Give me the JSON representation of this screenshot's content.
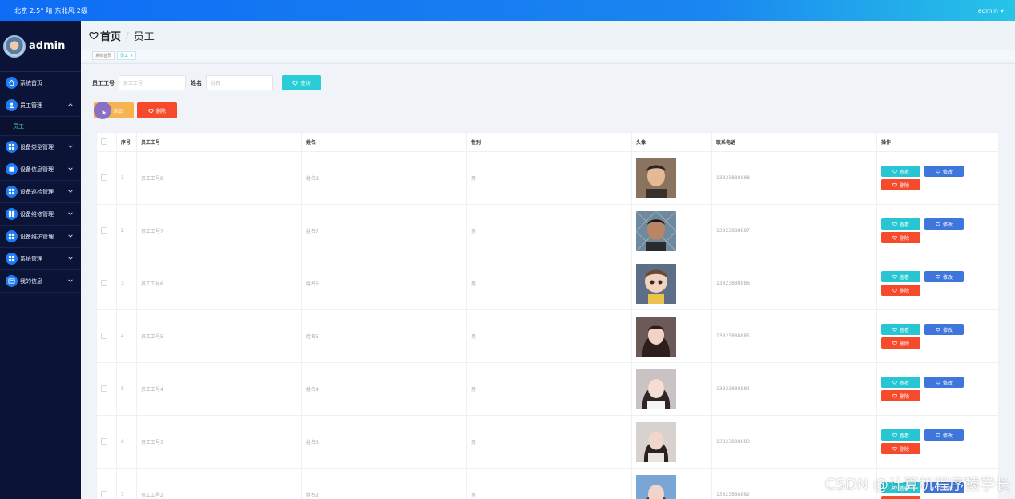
{
  "topbar": {
    "weather": "北京  2.5°  晴  东北风  2级",
    "user": "admin"
  },
  "sidebar": {
    "brand": "admin",
    "items": [
      {
        "label": "系统首页",
        "icon": "home-icon",
        "expanded": false
      },
      {
        "label": "员工管理",
        "icon": "user-icon",
        "expanded": true,
        "sub": [
          "员工"
        ]
      },
      {
        "label": "设备类型管理",
        "icon": "grid-icon",
        "expanded": false
      },
      {
        "label": "设备信息管理",
        "icon": "box-icon",
        "expanded": false
      },
      {
        "label": "设备巡检管理",
        "icon": "grid-icon",
        "expanded": false
      },
      {
        "label": "设备维修管理",
        "icon": "grid-icon",
        "expanded": false
      },
      {
        "label": "设备维护管理",
        "icon": "grid-icon",
        "expanded": false
      },
      {
        "label": "系统管理",
        "icon": "grid-icon",
        "expanded": false
      },
      {
        "label": "我的信息",
        "icon": "card-icon",
        "expanded": false
      }
    ]
  },
  "header": {
    "home": "首页",
    "current": "员工"
  },
  "tags": [
    {
      "label": "系统首页",
      "active": false
    },
    {
      "label": "员工",
      "active": true
    }
  ],
  "search": {
    "id_label": "员工工号",
    "id_placeholder": "员工工号",
    "name_label": "姓名",
    "name_placeholder": "姓名",
    "button": "查询"
  },
  "actions": {
    "add": "添加",
    "delete": "删除"
  },
  "table": {
    "columns": [
      "序号",
      "员工工号",
      "姓名",
      "性别",
      "头像",
      "联系电话",
      "操作"
    ],
    "rows": [
      {
        "no": "1",
        "id": "员工工号8",
        "name": "姓名8",
        "gender": "男",
        "phone": "13823888888"
      },
      {
        "no": "2",
        "id": "员工工号7",
        "name": "姓名7",
        "gender": "男",
        "phone": "13823888887"
      },
      {
        "no": "3",
        "id": "员工工号6",
        "name": "姓名6",
        "gender": "男",
        "phone": "13823888886"
      },
      {
        "no": "4",
        "id": "员工工号5",
        "name": "姓名5",
        "gender": "男",
        "phone": "13823888885"
      },
      {
        "no": "5",
        "id": "员工工号4",
        "name": "姓名4",
        "gender": "男",
        "phone": "13823888884"
      },
      {
        "no": "6",
        "id": "员工工号3",
        "name": "姓名3",
        "gender": "男",
        "phone": "13823888883"
      },
      {
        "no": "7",
        "id": "员工工号2",
        "name": "姓名2",
        "gender": "男",
        "phone": "13823888882"
      }
    ],
    "ops": {
      "view": "查看",
      "edit": "修改",
      "delete": "删除"
    }
  },
  "watermark": "CSDN @计算机程序猿学长",
  "colors": {
    "primary": "#0f6cf5",
    "sidebar": "#0b1437",
    "search": "#29cdd6",
    "add": "#f7b34f",
    "danger": "#f64a2c",
    "edit": "#3e76dc"
  }
}
